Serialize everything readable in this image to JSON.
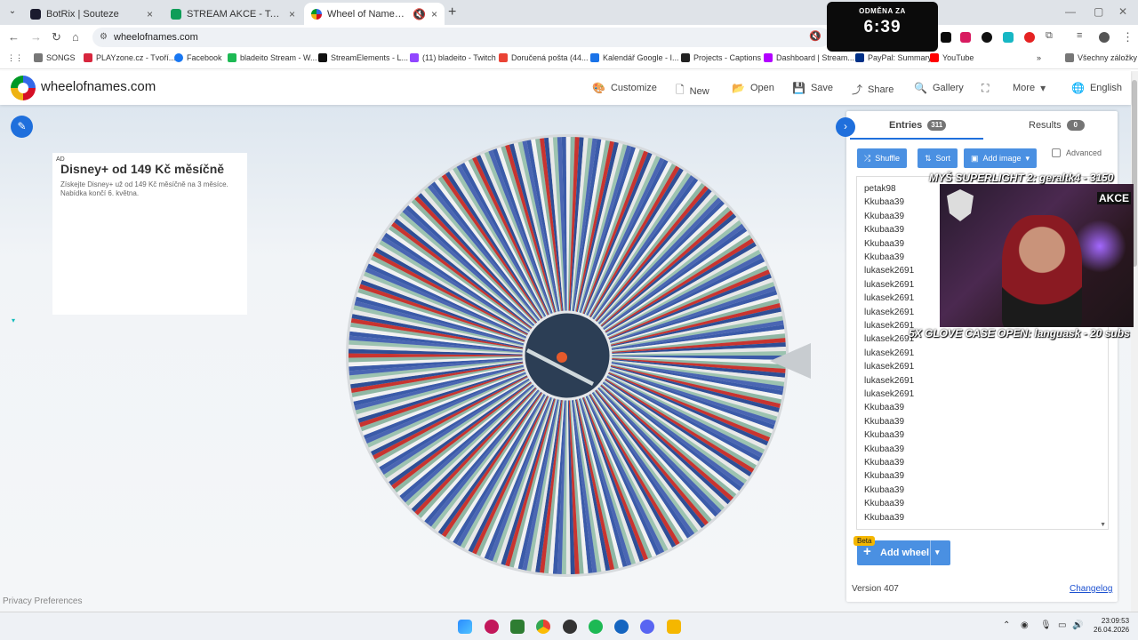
{
  "browser": {
    "tabs": [
      {
        "label": "BotRix | Souteze",
        "color": "#1b1b2e"
      },
      {
        "label": "STREAM AKCE - Tabulky Google",
        "color": "#0f9d58"
      },
      {
        "label": "Wheel of Names | Random",
        "color": "#ea4335"
      }
    ],
    "url": "wheelofnames.com",
    "bookmarks": [
      {
        "label": "SONGS",
        "color": "#777777"
      },
      {
        "label": "PLAYzone.cz - Tvoří...",
        "color": "#d7263d"
      },
      {
        "label": "Facebook",
        "color": "#1877f2"
      },
      {
        "label": "bladeito Stream - W...",
        "color": "#1db954"
      },
      {
        "label": "StreamElements - L...",
        "color": "#111111"
      },
      {
        "label": "(11) bladeito - Twitch",
        "color": "#9146ff"
      },
      {
        "label": "Doručená pošta (44...",
        "color": "#ea4335"
      },
      {
        "label": "Kalendář Google - I...",
        "color": "#1a73e8"
      },
      {
        "label": "Projects - Captions",
        "color": "#222222"
      },
      {
        "label": "Dashboard | Stream...",
        "color": "#b200ff"
      },
      {
        "label": "PayPal: Summary",
        "color": "#003087"
      },
      {
        "label": "YouTube",
        "color": "#ff0000"
      }
    ],
    "all_bookmarks": "Všechny záložky"
  },
  "timer": {
    "label": "ODMĚNA ZA",
    "value": "6:39"
  },
  "site": {
    "name": "wheelofnames.com",
    "menu": [
      "Customize",
      "New",
      "Open",
      "Save",
      "Share",
      "Gallery",
      "More",
      "English"
    ]
  },
  "ad": {
    "tag": "AD",
    "title": "Disney+ od 149 Kč měsíčně",
    "text": "Získejte Disney+ už od 149 Kč měsíčně na 3 měsíce. Nabídka končí 6. května."
  },
  "privacy": "Privacy Preferences",
  "panel": {
    "entries_tab": "Entries",
    "entries_count": "311",
    "results_tab": "Results",
    "results_count": "0",
    "shuffle": "Shuffle",
    "sort": "Sort",
    "add_image": "Add image",
    "advanced": "Advanced",
    "entries": [
      "petak98",
      "Kkubaa39",
      "Kkubaa39",
      "Kkubaa39",
      "Kkubaa39",
      "Kkubaa39",
      "lukasek2691",
      "lukasek2691",
      "lukasek2691",
      "lukasek2691",
      "lukasek2691",
      "lukasek2691",
      "lukasek2691",
      "lukasek2691",
      "lukasek2691",
      "lukasek2691",
      "Kkubaa39",
      "Kkubaa39",
      "Kkubaa39",
      "Kkubaa39",
      "Kkubaa39",
      "Kkubaa39",
      "Kkubaa39",
      "Kkubaa39",
      "Kkubaa39"
    ],
    "add_wheel": "Add wheel",
    "beta": "Beta",
    "version": "Version 407",
    "changelog": "Changelog"
  },
  "stream_overlay": {
    "top": "MYŠ SUPERLIGHT 2: geraltk4 - 3150",
    "bottom": "5X GLOVE CASE OPEN: languask - 20 subs",
    "tag": "AKCE"
  },
  "wheel": {
    "segment_colors": [
      "#3b5ba9",
      "#f2f2f2",
      "#8fb7a4",
      "#c9342f",
      "#2f4e96",
      "#e8e8e8",
      "#9cc3b0",
      "#4a66b3"
    ]
  },
  "taskbar": {
    "time": "23:09:53",
    "date": "26.04.2026"
  }
}
